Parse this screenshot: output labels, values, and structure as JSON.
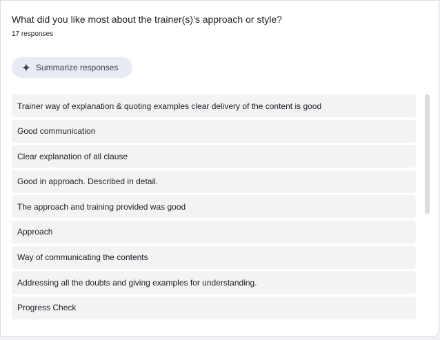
{
  "question": {
    "title": "What did you like most about the trainer(s)’s approach or style?",
    "response_count": "17 responses"
  },
  "summarize_button": {
    "label": "Summarize responses",
    "icon": "sparkle-icon"
  },
  "responses": [
    "Trainer way of explanation & quoting examples clear delivery of the content is good",
    "Good communication",
    "Clear explanation of all clause",
    "Good in approach. Described in detail.",
    "The approach and training provided was good",
    "Approach",
    "Way of communicating the contents",
    "Addressing all the doubts and giving examples for understanding.",
    "Progress Check"
  ],
  "colors": {
    "card_background": "#ffffff",
    "page_background": "#f0f2f5",
    "row_background": "#f1f3f4",
    "button_background": "#e8ebf4",
    "text": "#202124",
    "scrollbar_thumb": "#dadce0"
  }
}
